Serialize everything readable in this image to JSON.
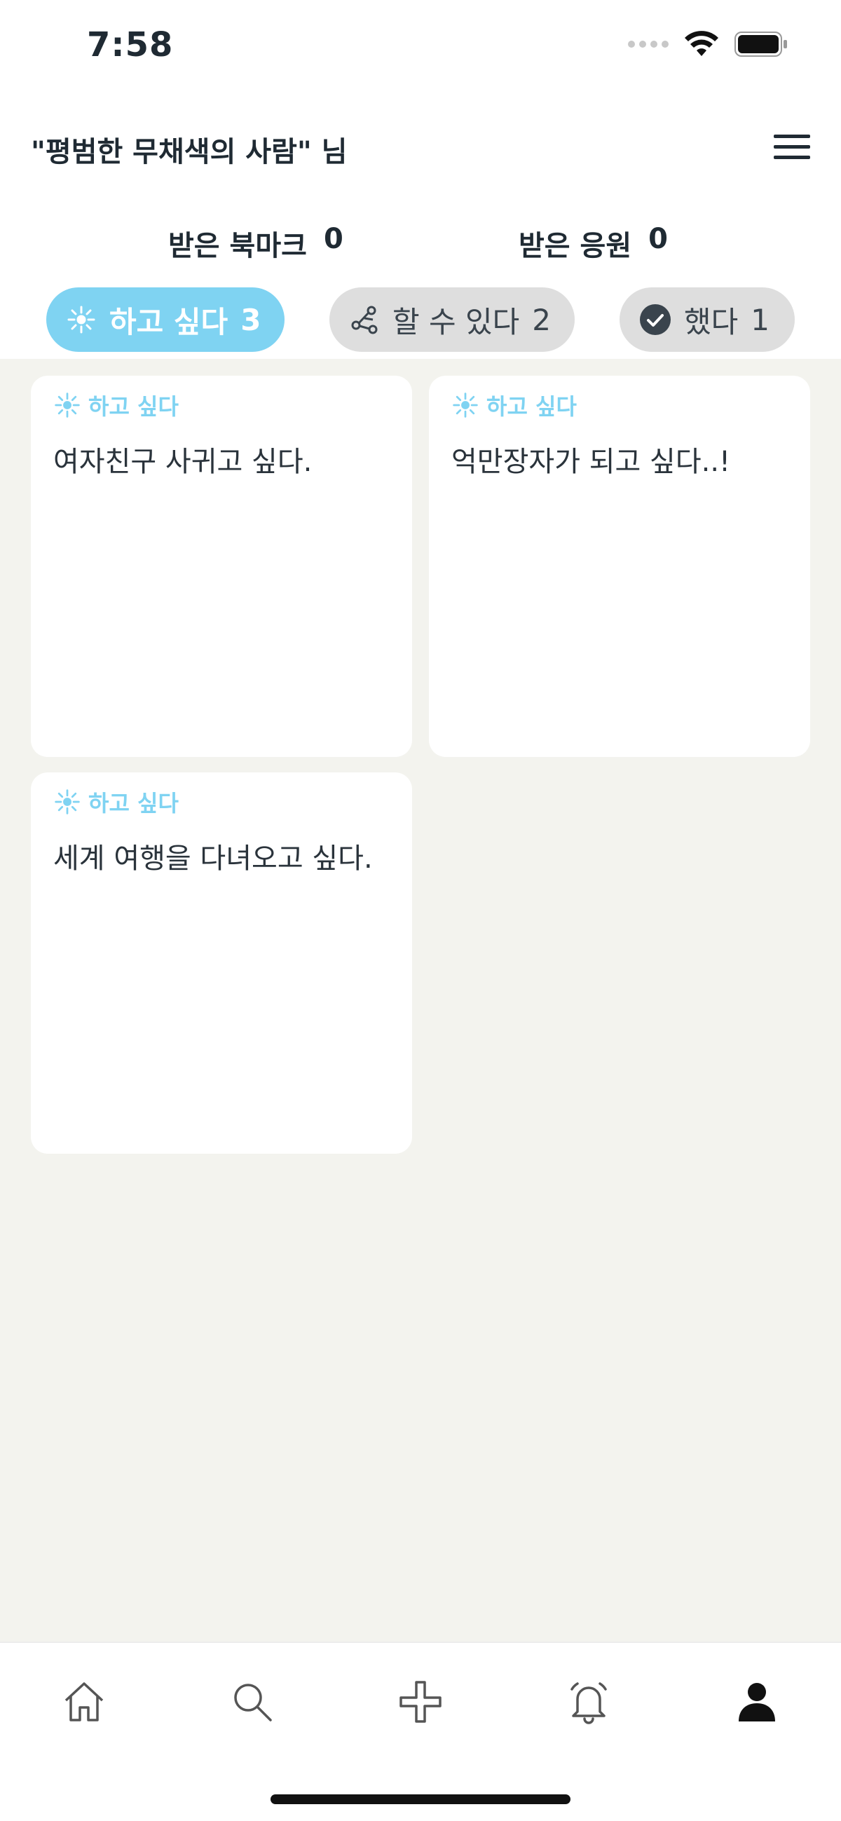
{
  "status_bar": {
    "time": "7:58"
  },
  "header": {
    "title": "\"평범한 무채색의 사람\" 님"
  },
  "stats": {
    "bookmark_label": "받은 북마크",
    "bookmark_count": "0",
    "cheer_label": "받은 응원",
    "cheer_count": "0"
  },
  "tabs": [
    {
      "label": "하고 싶다",
      "count": "3",
      "icon": "sparkle-icon",
      "active": true
    },
    {
      "label": "할 수 있다",
      "count": "2",
      "icon": "share-nodes-icon",
      "active": false
    },
    {
      "label": "했다",
      "count": "1",
      "icon": "check-circle-icon",
      "active": false
    }
  ],
  "cards": [
    {
      "tag": "하고 싶다",
      "text": "여자친구 사귀고 싶다."
    },
    {
      "tag": "하고 싶다",
      "text": "억만장자가 되고 싶다..!"
    },
    {
      "tag": "하고 싶다",
      "text": "세계 여행을 다녀오고 싶다."
    }
  ],
  "bottom_nav": [
    "home-icon",
    "search-icon",
    "plus-icon",
    "bell-icon",
    "profile-icon"
  ],
  "colors": {
    "accent": "#7fd3f2",
    "tab_inactive": "#dedede",
    "background": "#f3f3ee",
    "text": "#1f2a33"
  }
}
